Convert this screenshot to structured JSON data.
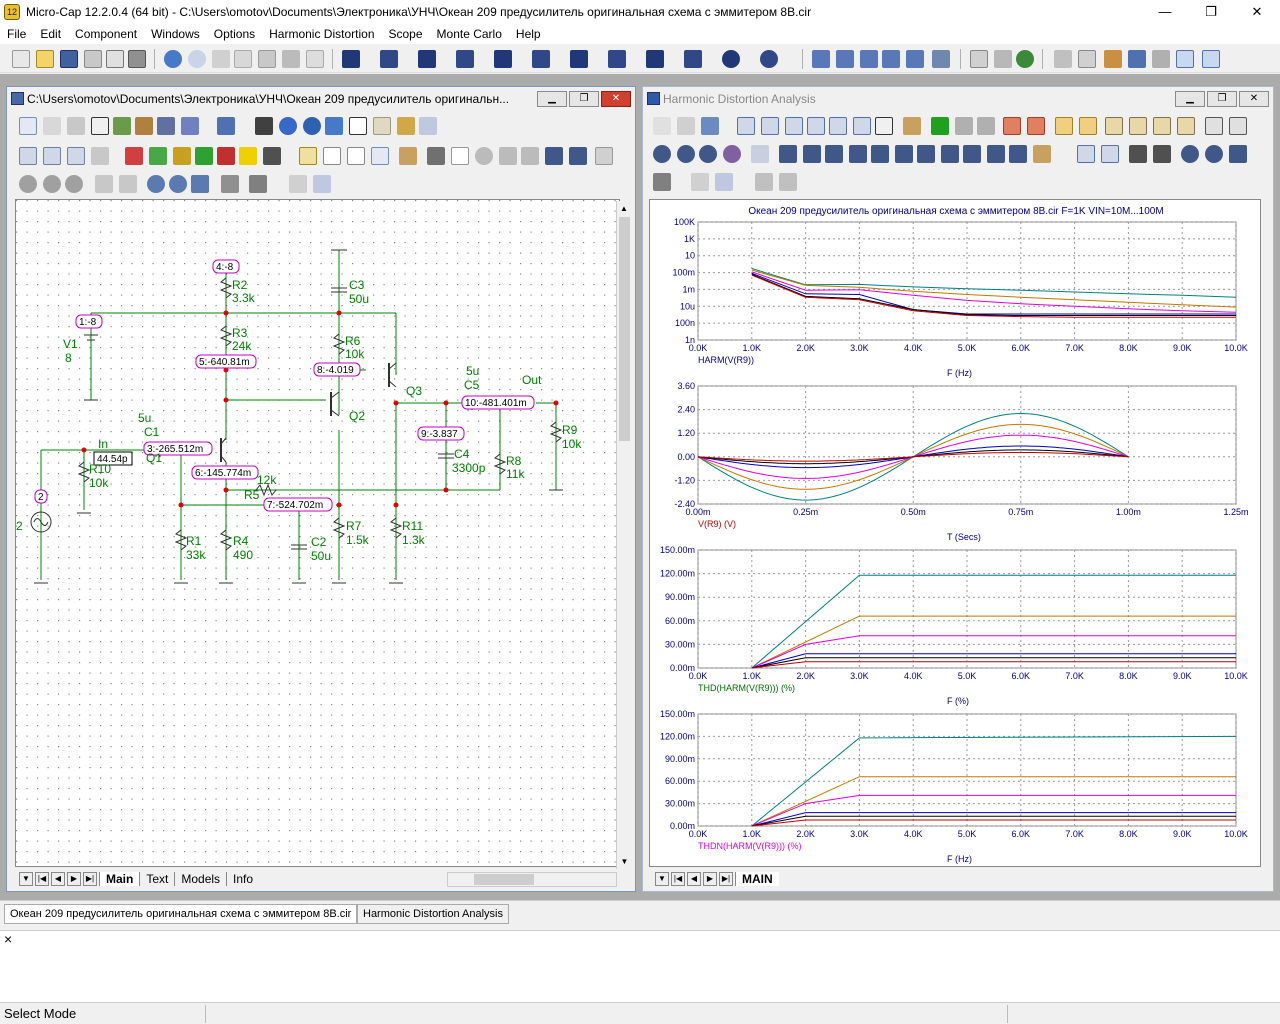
{
  "window": {
    "app_icon_label": "12",
    "title": "Micro-Cap 12.2.0.4 (64 bit) - C:\\Users\\omotov\\Documents\\Электроника\\УНЧ\\Океан 209 предусилитель оригинальная схема с эммитером 8В.cir",
    "minimize": "—",
    "restore": "❐",
    "close": "✕"
  },
  "menu": [
    "File",
    "Edit",
    "Component",
    "Windows",
    "Options",
    "Harmonic Distortion",
    "Scope",
    "Monte Carlo",
    "Help"
  ],
  "schematic_window": {
    "title": "C:\\Users\\omotov\\Documents\\Электроника\\УНЧ\\Океан 209 предусилитель оригинальн...",
    "tabs": [
      "Main",
      "Text",
      "Models",
      "Info"
    ]
  },
  "schematic": {
    "nodes": [
      {
        "label": "4:-8"
      },
      {
        "label": "1:-8"
      },
      {
        "label": "5:-640.81m"
      },
      {
        "label": "8:-4.019"
      },
      {
        "label": "3:-265.512m"
      },
      {
        "label": "6:-145.774m"
      },
      {
        "label": "44.54p"
      },
      {
        "label": "7:-524.702m"
      },
      {
        "label": "9:-3.837"
      },
      {
        "label": "10:-481.401m"
      },
      {
        "label": "2"
      }
    ],
    "components": [
      {
        "name": "R2",
        "value": "3.3k"
      },
      {
        "name": "R3",
        "value": "24k"
      },
      {
        "name": "C3",
        "value": "50u"
      },
      {
        "name": "R6",
        "value": "10k"
      },
      {
        "name": "V1",
        "value": "8"
      },
      {
        "name": "Q3",
        "value": ""
      },
      {
        "name": "Q2",
        "value": ""
      },
      {
        "name": "Q1",
        "value": ""
      },
      {
        "name": "C5",
        "value": "5u"
      },
      {
        "name": "C1",
        "value": "5u"
      },
      {
        "name": "R10",
        "value": "10k"
      },
      {
        "name": "R5",
        "value": "12k"
      },
      {
        "name": "R9",
        "value": "10k"
      },
      {
        "name": "C4",
        "value": "3300p"
      },
      {
        "name": "R8",
        "value": "11k"
      },
      {
        "name": "R1",
        "value": "33k"
      },
      {
        "name": "R4",
        "value": "490"
      },
      {
        "name": "C2",
        "value": "50u"
      },
      {
        "name": "R7",
        "value": "1.5k"
      },
      {
        "name": "R11",
        "value": "1.3k"
      }
    ],
    "texts": {
      "in": "In",
      "out": "Out",
      "v2": "2"
    }
  },
  "analysis_window": {
    "title": "Harmonic Distortion Analysis",
    "chart_title": "Океан 209 предусилитель оригинальная схема с эммитером 8В.cir F=1K VIN=10M...100M",
    "tab": "MAIN"
  },
  "colors": {
    "series": [
      "#008080",
      "#c07800",
      "#e000e0",
      "#0000c0",
      "#000000",
      "#c00000",
      "#007000"
    ],
    "wire": "#008000",
    "node_box": "#c000c0",
    "grid": "#888888"
  },
  "chart_data": [
    {
      "type": "line",
      "xlabel": "F (Hz)",
      "ylabel": "HARM(V(R9))",
      "x_ticks": [
        "0.0K",
        "1.0K",
        "2.0K",
        "3.0K",
        "4.0K",
        "5.0K",
        "6.0K",
        "7.0K",
        "8.0K",
        "9.0K",
        "10.0K"
      ],
      "y_ticks": [
        "100K",
        "1K",
        "10",
        "100m",
        "1m",
        "10u",
        "100n",
        "1n"
      ],
      "y_scale": "log",
      "xlim": [
        0,
        10000
      ],
      "ylim": [
        1e-09,
        100000
      ],
      "grid": true,
      "series": [
        {
          "x": [
            1000,
            2000,
            3000,
            4000,
            5000,
            6000,
            7000,
            8000,
            9000,
            10000
          ],
          "y": [
            0.3,
            0.0035,
            0.004,
            0.002,
            0.0012,
            0.0008,
            0.0005,
            0.0003,
            0.0002,
            0.00012
          ]
        },
        {
          "x": [
            1000,
            2000,
            3000,
            4000,
            5000,
            6000,
            7000,
            8000,
            9000,
            10000
          ],
          "y": [
            0.2,
            0.003,
            0.0018,
            0.0006,
            0.00025,
            0.00012,
            6e-05,
            3e-05,
            1.5e-05,
            8e-06
          ]
        },
        {
          "x": [
            1000,
            2000,
            3000,
            4000,
            5000,
            6000,
            7000,
            8000,
            9000,
            10000
          ],
          "y": [
            0.12,
            0.0008,
            0.0009,
            0.0002,
            5e-05,
            2e-05,
            1e-05,
            5e-06,
            3e-06,
            2e-06
          ]
        },
        {
          "x": [
            1000,
            2000,
            3000,
            4000,
            5000,
            6000,
            7000,
            8000,
            9000,
            10000
          ],
          "y": [
            0.08,
            0.0003,
            0.00025,
            4e-06,
            1.2e-06,
            1.2e-06,
            1.2e-06,
            1.2e-06,
            1.2e-06,
            1.2e-06
          ]
        },
        {
          "x": [
            1000,
            2000,
            3000,
            4000,
            5000,
            6000,
            7000,
            8000,
            9000,
            10000
          ],
          "y": [
            0.06,
            0.00015,
            8e-05,
            4e-06,
            1e-06,
            8e-07,
            8e-07,
            8e-07,
            8e-07,
            8e-07
          ]
        },
        {
          "x": [
            1000,
            2000,
            3000,
            4000,
            5000,
            6000,
            7000,
            8000,
            9000,
            10000
          ],
          "y": [
            0.05,
            0.00012,
            6e-05,
            3e-06,
            8e-07,
            6e-07,
            5e-07,
            5e-07,
            5e-07,
            5e-07
          ]
        }
      ]
    },
    {
      "type": "line",
      "xlabel": "T (Secs)",
      "ylabel": "V(R9) (V)",
      "x_ticks": [
        "0.00m",
        "0.25m",
        "0.50m",
        "0.75m",
        "1.00m",
        "1.25m"
      ],
      "y_ticks": [
        "3.60",
        "2.40",
        "1.20",
        "0.00",
        "-1.20",
        "-2.40"
      ],
      "xlim": [
        0,
        0.00125
      ],
      "ylim": [
        -2.4,
        3.6
      ],
      "grid": true,
      "series": [
        {
          "amplitude": 2.2
        },
        {
          "amplitude": 1.65
        },
        {
          "amplitude": 1.1
        },
        {
          "amplitude": 0.55
        },
        {
          "amplitude": 0.35
        },
        {
          "amplitude": 0.22
        }
      ]
    },
    {
      "type": "line",
      "xlabel": "F (%)",
      "ylabel": "THD(HARM(V(R9))) (%)",
      "x_ticks": [
        "0.0K",
        "1.0K",
        "2.0K",
        "3.0K",
        "4.0K",
        "5.0K",
        "6.0K",
        "7.0K",
        "8.0K",
        "9.0K",
        "10.0K"
      ],
      "y_ticks": [
        "150.00m",
        "120.00m",
        "90.00m",
        "60.00m",
        "30.00m",
        "0.00m"
      ],
      "xlim": [
        0,
        10000
      ],
      "ylim": [
        0,
        0.15
      ],
      "grid": true,
      "series": [
        {
          "x": [
            1000,
            3000,
            10000
          ],
          "y": [
            0,
            0.118,
            0.118
          ]
        },
        {
          "x": [
            1000,
            3000,
            10000
          ],
          "y": [
            0,
            0.066,
            0.066
          ]
        },
        {
          "x": [
            1000,
            2000,
            3000,
            10000
          ],
          "y": [
            0,
            0.03,
            0.041,
            0.041
          ]
        },
        {
          "x": [
            1000,
            2000,
            10000
          ],
          "y": [
            0,
            0.018,
            0.018
          ]
        },
        {
          "x": [
            1000,
            2000,
            10000
          ],
          "y": [
            0,
            0.013,
            0.013
          ]
        },
        {
          "x": [
            1000,
            2000,
            10000
          ],
          "y": [
            0,
            0.008,
            0.008
          ]
        }
      ]
    },
    {
      "type": "line",
      "xlabel": "F (Hz)",
      "ylabel": "THDN(HARM(V(R9))) (%)",
      "x_ticks": [
        "0.0K",
        "1.0K",
        "2.0K",
        "3.0K",
        "4.0K",
        "5.0K",
        "6.0K",
        "7.0K",
        "8.0K",
        "9.0K",
        "10.0K"
      ],
      "y_ticks": [
        "150.00m",
        "120.00m",
        "90.00m",
        "60.00m",
        "30.00m",
        "0.00m"
      ],
      "xlim": [
        0,
        10000
      ],
      "ylim": [
        0,
        0.15
      ],
      "grid": true,
      "series": [
        {
          "x": [
            1000,
            3000,
            10000
          ],
          "y": [
            0,
            0.118,
            0.12
          ]
        },
        {
          "x": [
            1000,
            3000,
            10000
          ],
          "y": [
            0,
            0.066,
            0.066
          ]
        },
        {
          "x": [
            1000,
            2000,
            3000,
            10000
          ],
          "y": [
            0,
            0.03,
            0.041,
            0.041
          ]
        },
        {
          "x": [
            1000,
            2000,
            10000
          ],
          "y": [
            0,
            0.018,
            0.018
          ]
        },
        {
          "x": [
            1000,
            2000,
            10000
          ],
          "y": [
            0,
            0.013,
            0.013
          ]
        },
        {
          "x": [
            1000,
            2000,
            10000
          ],
          "y": [
            0,
            0.008,
            0.008
          ]
        }
      ]
    }
  ],
  "doc_tabs": [
    "Океан 209 предусилитель оригинальная схема с эммитером 8В.cir",
    "Harmonic Distortion Analysis"
  ],
  "output_pane": {
    "close": "×"
  },
  "status": {
    "mode": "Select Mode"
  }
}
